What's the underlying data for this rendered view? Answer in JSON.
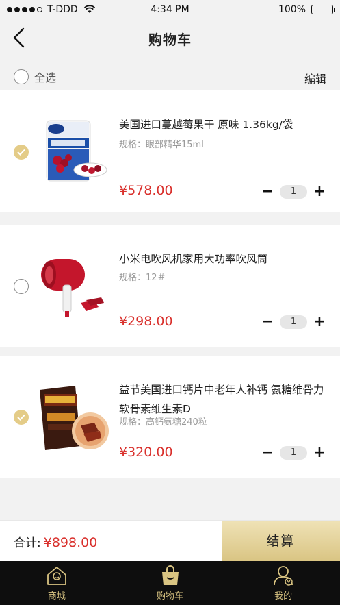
{
  "status_bar": {
    "carrier": "T-DDD",
    "time": "4:34 PM",
    "battery": "100%"
  },
  "header": {
    "title": "购物车"
  },
  "select_bar": {
    "select_all_label": "全选",
    "edit_label": "编辑"
  },
  "items": [
    {
      "title": "美国进口蔓越莓果干 原味 1.36kg/袋",
      "spec": "规格：眼部精华15ml",
      "price": "¥578.00",
      "quantity": "1",
      "checked": true,
      "image_icon": "dried-cranberries-bag-image"
    },
    {
      "title": "小米电吹风机家用大功率吹风筒",
      "spec": "规格：12＃",
      "price": "¥298.00",
      "quantity": "1",
      "checked": false,
      "image_icon": "hair-dryer-image"
    },
    {
      "title": "益节美国进口钙片中老年人补钙 氨糖维骨力软骨素维生素D",
      "spec": "规格：高钙氨糖240粒",
      "price": "¥320.00",
      "quantity": "1",
      "checked": true,
      "image_icon": "beef-jerky-bag-image"
    }
  ],
  "stepper": {
    "minus": "−",
    "plus": "+"
  },
  "checkout": {
    "total_label": "合计:",
    "total_amount": "¥898.00",
    "button_label": "结算"
  },
  "tabs": [
    {
      "label": "商城",
      "icon": "house-icon"
    },
    {
      "label": "购物车",
      "icon": "shopping-bag-icon",
      "active": true
    },
    {
      "label": "我的",
      "icon": "user-icon"
    }
  ],
  "colors": {
    "accent_gold": "#d9c482",
    "price_red": "#d9302c",
    "tab_bar_bg": "#0e0e0e"
  }
}
